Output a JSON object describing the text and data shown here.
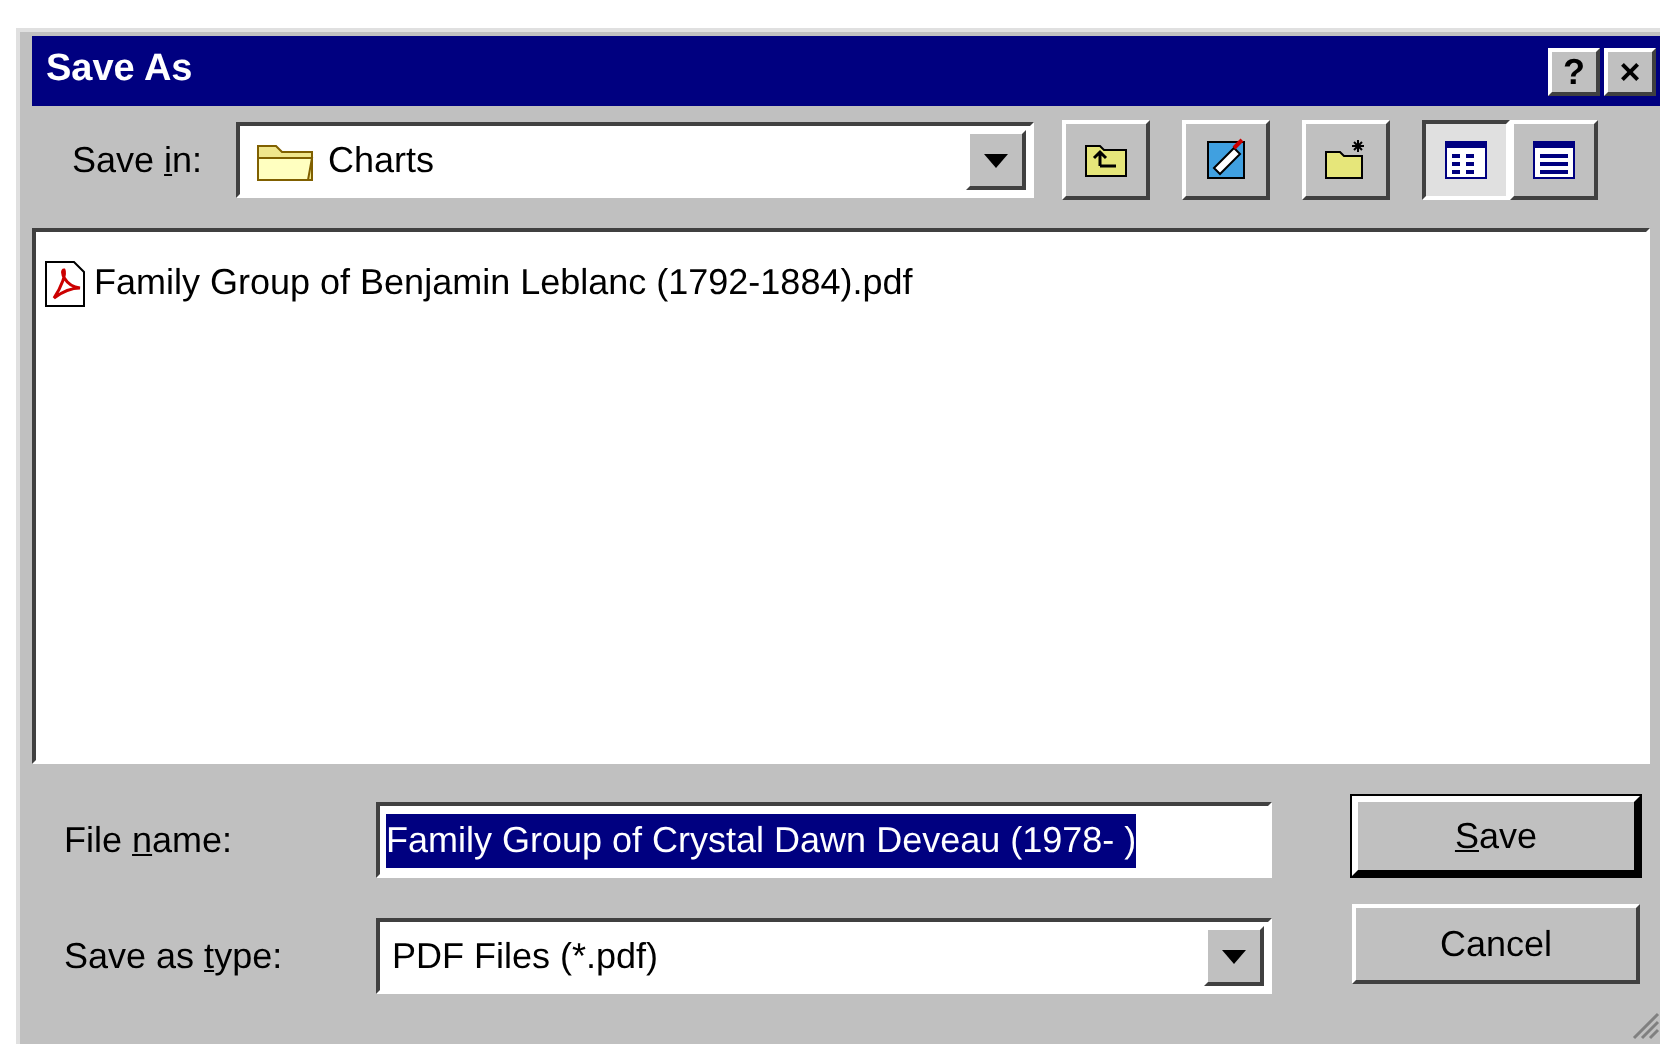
{
  "window": {
    "title": "Save As",
    "title_buttons": [
      "?",
      "×"
    ]
  },
  "save_in": {
    "label": {
      "before": "Save ",
      "key": "i",
      "after": "n:"
    },
    "value": "Charts"
  },
  "toolbar": [
    {
      "kind": "up",
      "selected": false
    },
    {
      "kind": "desktop",
      "selected": false
    },
    {
      "kind": "new_folder",
      "selected": false
    },
    {
      "kind": "list",
      "selected": true
    },
    {
      "kind": "details",
      "selected": false
    }
  ],
  "files": [
    {
      "name": "Family Group of Benjamin Leblanc (1792-1884).pdf",
      "selected": false
    }
  ],
  "file_name": {
    "label": {
      "before": "File ",
      "key": "n",
      "after": "ame:"
    },
    "value": "Family Group of Crystal Dawn Deveau (1978- )"
  },
  "save_as_type": {
    "label": {
      "before": "Save as ",
      "key": "t",
      "after": "ype:"
    },
    "value": "PDF Files (*.pdf)"
  },
  "buttons": [
    {
      "kind": "default",
      "label": {
        "key": "S",
        "after": "ave"
      }
    },
    {
      "kind": "normal",
      "label": {
        "before": "Cancel"
      }
    }
  ]
}
